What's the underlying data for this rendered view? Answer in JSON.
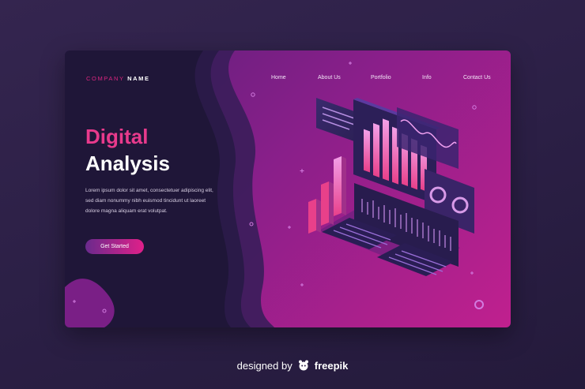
{
  "brand": {
    "part1": "COMPANY",
    "part2": "NAME"
  },
  "nav": {
    "items": [
      "Home",
      "About Us",
      "Portfolio",
      "Info",
      "Contact Us"
    ]
  },
  "hero": {
    "line1": "Digital",
    "line2": "Analysis",
    "body": [
      "Lorem ipsum dolor sit amet, consectetuer adipiscing elit,",
      "sed diam nonummy nibh euismod tincidunt ut laoreet",
      "dolore magna aliquam erat volutpat."
    ],
    "cta_label": "Get Started"
  },
  "credit": {
    "prefix": "designed by",
    "brand": "freepik",
    "icon": "freepik-logo-icon"
  },
  "colors": {
    "accent": "#e83a8c",
    "dark_panel": "#1f1638",
    "card_gradient_start": "#5a1f7a",
    "card_gradient_end": "#c0208e"
  }
}
